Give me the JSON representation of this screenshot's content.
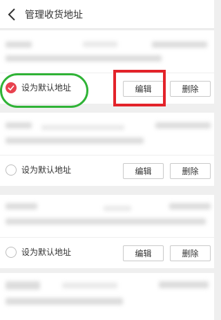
{
  "header": {
    "title": "管理收货地址",
    "back_icon": "chevron-left-icon"
  },
  "addresses": [
    {
      "default_label": "设为默认地址",
      "is_default": true,
      "edit_label": "编辑",
      "delete_label": "删除"
    },
    {
      "default_label": "设为默认地址",
      "is_default": false,
      "edit_label": "编辑",
      "delete_label": "删除"
    },
    {
      "default_label": "设为默认地址",
      "is_default": false,
      "edit_label": "编辑",
      "delete_label": "删除"
    },
    {
      "default_label": "",
      "is_default": false,
      "edit_label": "",
      "delete_label": ""
    }
  ],
  "colors": {
    "accent_red": "#e8424f",
    "highlight_green": "#2fb336",
    "highlight_red": "#e3232a"
  }
}
